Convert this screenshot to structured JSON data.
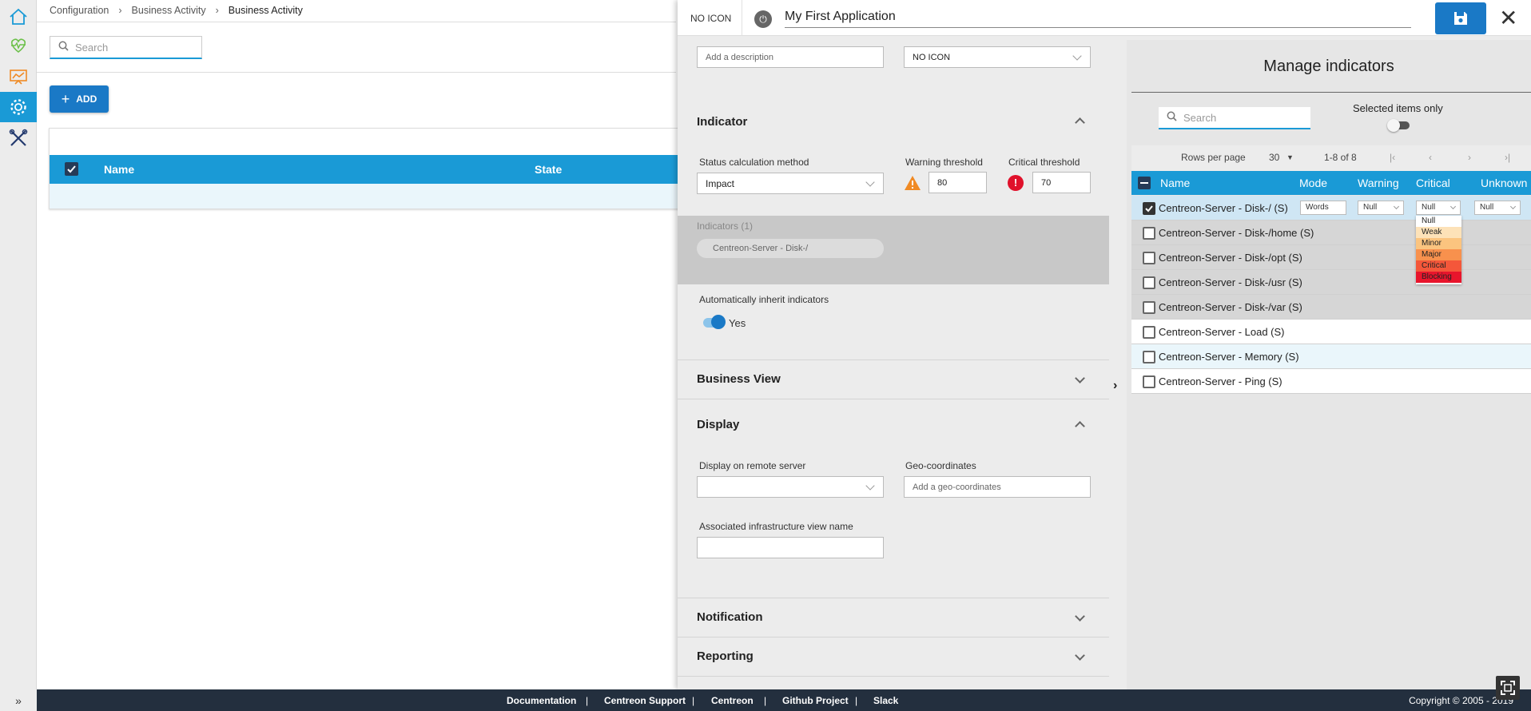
{
  "breadcrumb": [
    "Configuration",
    "Business Activity",
    "Business Activity"
  ],
  "background": {
    "search_placeholder": "Search",
    "add_label": "ADD",
    "columns": [
      "Name",
      "State"
    ]
  },
  "header": {
    "icon_label": "NO ICON",
    "app_title": "My First Application"
  },
  "form": {
    "description_placeholder": "Add a description",
    "icon_select_value": "NO ICON",
    "indicator_section": "Indicator",
    "status_calc_label": "Status calculation method",
    "status_calc_value": "Impact",
    "warning_label": "Warning threshold",
    "warning_value": "80",
    "critical_label": "Critical threshold",
    "critical_value": "70",
    "indicators_count_label": "Indicators (1)",
    "indicator_chip": "Centreon-Server - Disk-/",
    "auto_inherit_label": "Automatically inherit indicators",
    "auto_inherit_value": "Yes",
    "business_view_section": "Business View",
    "display_section": "Display",
    "remote_server_label": "Display on remote server",
    "geo_label": "Geo-coordinates",
    "geo_placeholder": "Add a geo-coordinates",
    "infra_view_label": "Associated infrastructure view name",
    "notification_section": "Notification",
    "reporting_section": "Reporting"
  },
  "indicators_panel": {
    "title": "Manage indicators",
    "search_placeholder": "Search",
    "selected_only_label": "Selected items only",
    "rows_per_page_label": "Rows per page",
    "rows_per_page_value": "30",
    "range": "1-8 of 8",
    "columns": [
      "Name",
      "Mode",
      "Warning",
      "Critical",
      "Unknown"
    ],
    "rows": [
      {
        "name": "Centreon-Server - Disk-/ (S)",
        "checked": true,
        "mode": "Words",
        "warning": "Null",
        "critical": "Null",
        "unknown": "Null"
      },
      {
        "name": "Centreon-Server - Disk-/home (S)",
        "checked": false
      },
      {
        "name": "Centreon-Server - Disk-/opt (S)",
        "checked": false
      },
      {
        "name": "Centreon-Server - Disk-/usr (S)",
        "checked": false
      },
      {
        "name": "Centreon-Server - Disk-/var (S)",
        "checked": false
      },
      {
        "name": "Centreon-Server - Load (S)",
        "checked": false
      },
      {
        "name": "Centreon-Server - Memory (S)",
        "checked": false
      },
      {
        "name": "Centreon-Server - Ping (S)",
        "checked": false
      }
    ],
    "critical_options": [
      {
        "label": "Null",
        "color": "#ffffff"
      },
      {
        "label": "Weak",
        "color": "#fde2b8"
      },
      {
        "label": "Minor",
        "color": "#fbc47f"
      },
      {
        "label": "Major",
        "color": "#f8914d"
      },
      {
        "label": "Critical",
        "color": "#f4573a"
      },
      {
        "label": "Blocking",
        "color": "#e8152c"
      }
    ]
  },
  "footer": {
    "links": [
      "Documentation",
      "Centreon Support",
      "Centreon",
      "Github Project",
      "Slack"
    ],
    "separator": "|",
    "copyright": "Copyright © 2005 - 2019"
  },
  "colors": {
    "accent": "#1a9ad6",
    "primary_button": "#1a79c6",
    "footer": "#232f3e"
  }
}
